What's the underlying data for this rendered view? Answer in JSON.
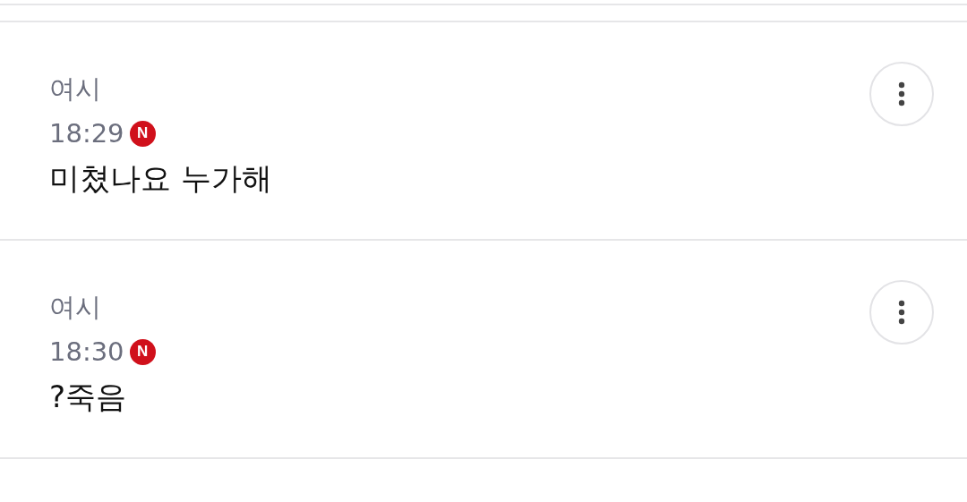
{
  "comments": [
    {
      "author": "여시",
      "time": "18:29",
      "badge": "N",
      "text": "미쳤나요 누가해"
    },
    {
      "author": "여시",
      "time": "18:30",
      "badge": "N",
      "text": "?죽음"
    }
  ]
}
